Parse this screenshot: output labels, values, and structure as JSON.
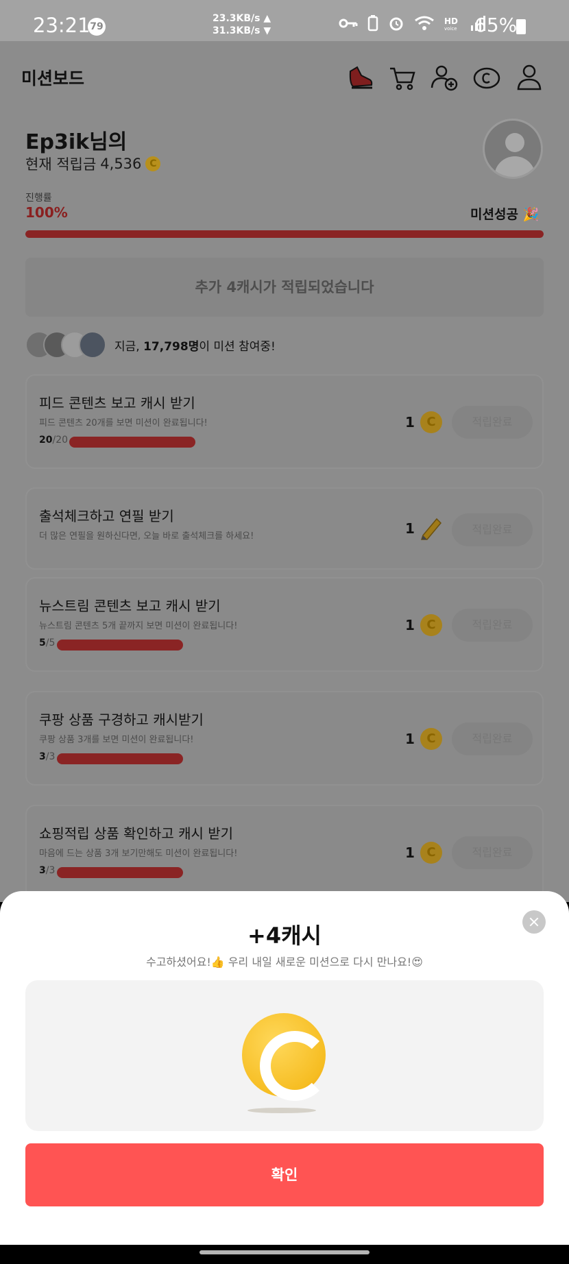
{
  "status_bar": {
    "time": "23:21",
    "notif_count": "79",
    "net_up": "23.3KB/s ▲",
    "net_down": "31.3KB/s ▼",
    "battery": "65%"
  },
  "header": {
    "title": "미션보드"
  },
  "profile": {
    "name": "Ep3ik님의",
    "cash_label": "현재 적립금",
    "cash_value": "4,536",
    "coin_symbol": "C"
  },
  "progress": {
    "label": "진행률",
    "value_text": "100%",
    "fraction": 1.0,
    "success_text": "미션성공 🎉"
  },
  "notice": "추가 4캐시가 적립되었습니다",
  "participants": {
    "prefix": "지금, ",
    "count": "17,798명",
    "suffix": "이 미션 참여중!"
  },
  "missions": [
    {
      "title": "피드 콘텐츠 보고 캐시 받기",
      "desc": "피드 콘텐츠 20개를 보면 미션이 완료됩니다!",
      "done": "20",
      "total": "/20",
      "reward": "1",
      "reward_icon": "coin-icon",
      "button": "적립완료",
      "progress": 1.0
    },
    {
      "title": "출석체크하고 연필 받기",
      "desc": "더 많은 연필을 원하신다면, 오늘 바로 출석체크를 하세요!",
      "reward": "1",
      "reward_icon": "pencil-icon",
      "button": "적립완료"
    },
    {
      "title": "뉴스트림 콘텐츠 보고 캐시 받기",
      "desc": "뉴스트림 콘텐츠 5개 끝까지 보면 미션이 완료됩니다!",
      "done": "5",
      "total": "/5",
      "reward": "1",
      "reward_icon": "coin-icon",
      "button": "적립완료",
      "progress": 1.0
    },
    {
      "title": "쿠팡 상품 구경하고 캐시받기",
      "desc": "쿠팡 상품 3개를 보면 미션이 완료됩니다!",
      "done": "3",
      "total": "/3",
      "reward": "1",
      "reward_icon": "coin-icon",
      "button": "적립완료",
      "progress": 1.0
    },
    {
      "title": "쇼핑적립 상품 확인하고 캐시 받기",
      "desc": "마음에 드는 상품 3개 보기만해도 미션이 완료됩니다!",
      "done": "3",
      "total": "/3",
      "reward": "1",
      "reward_icon": "coin-icon",
      "button": "적립완료",
      "progress": 1.0
    }
  ],
  "sheet": {
    "title": "+4캐시",
    "subtitle": "수고하셨어요!👍 우리 내일 새로운 미션으로 다시 만나요!😍",
    "confirm": "확인"
  },
  "colors": {
    "accent": "#ff5453",
    "coin": "#f6bd22"
  }
}
